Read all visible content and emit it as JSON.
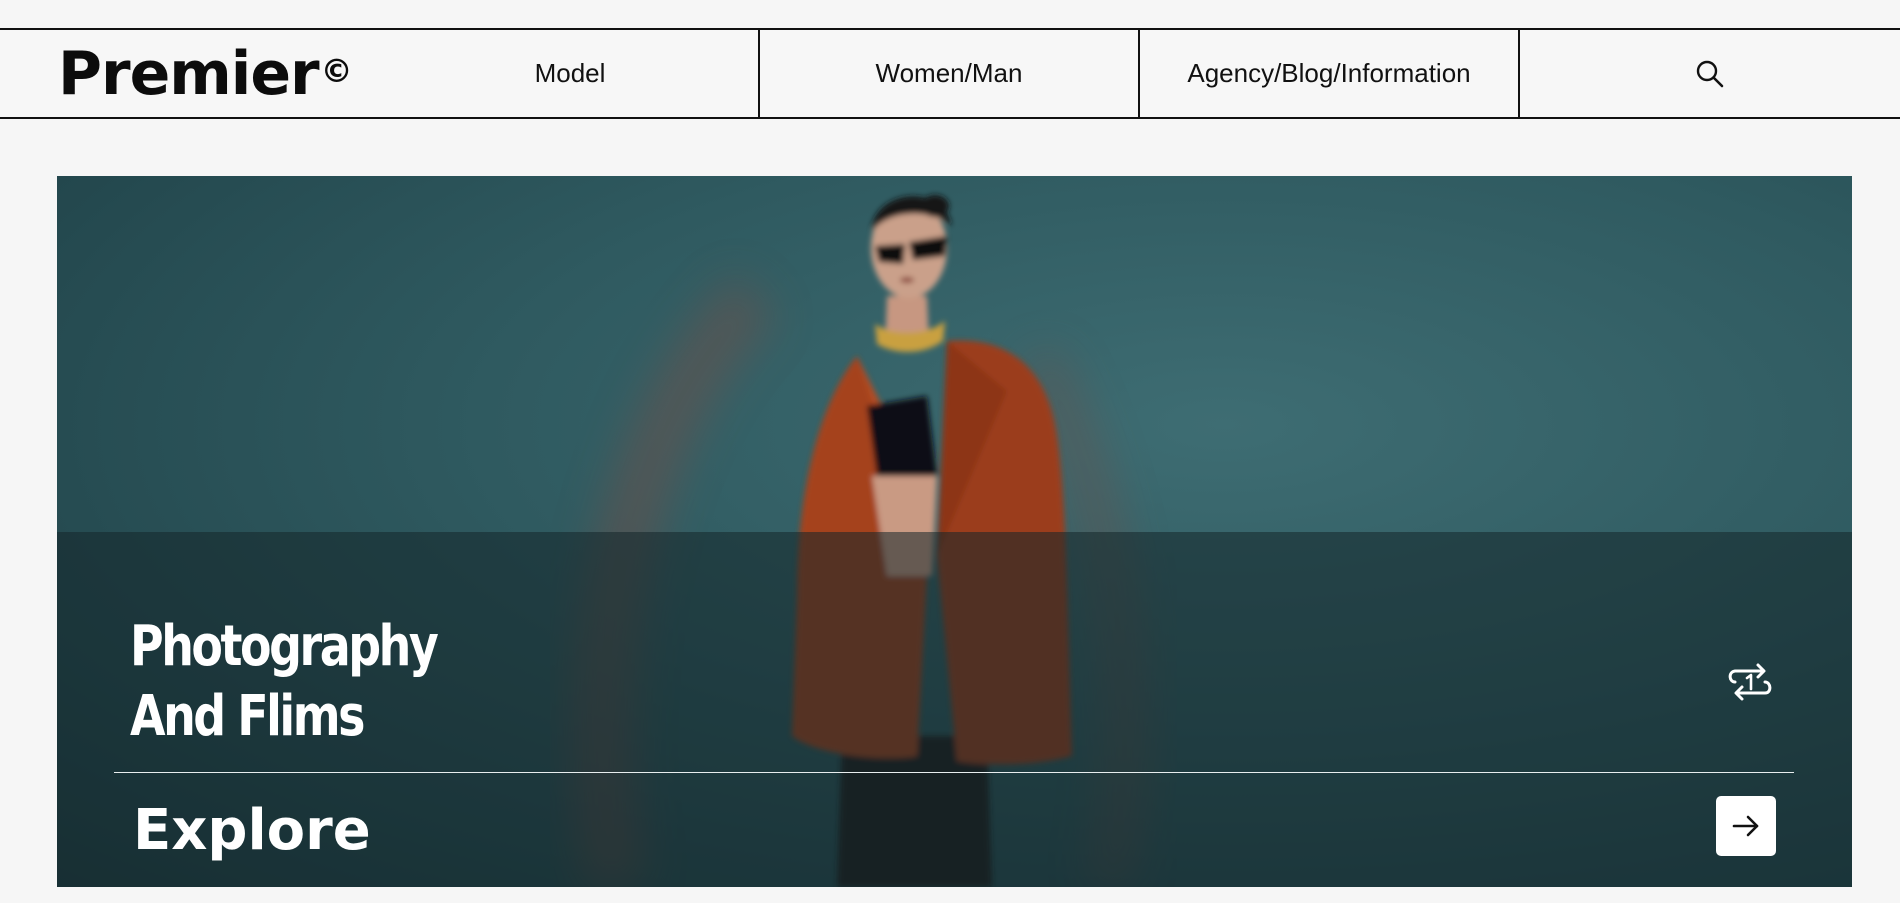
{
  "header": {
    "brand": "Premier",
    "brand_mark": "©",
    "nav": [
      {
        "label": "Model"
      },
      {
        "label": "Women/Man"
      },
      {
        "label": "Agency/Blog/Information"
      }
    ],
    "search_icon": "search-icon"
  },
  "hero": {
    "title_line1": "Photography",
    "title_line2": "And Flims",
    "repeat_icon": "repeat-one-icon",
    "explore_label": "Explore",
    "explore_icon": "arrow-right-icon"
  },
  "colors": {
    "page_background": "#f6f6f6",
    "hero_background": "#2f5a60",
    "jacket": "#a5421d",
    "text_light": "#ffffff",
    "text_dark": "#111111"
  }
}
